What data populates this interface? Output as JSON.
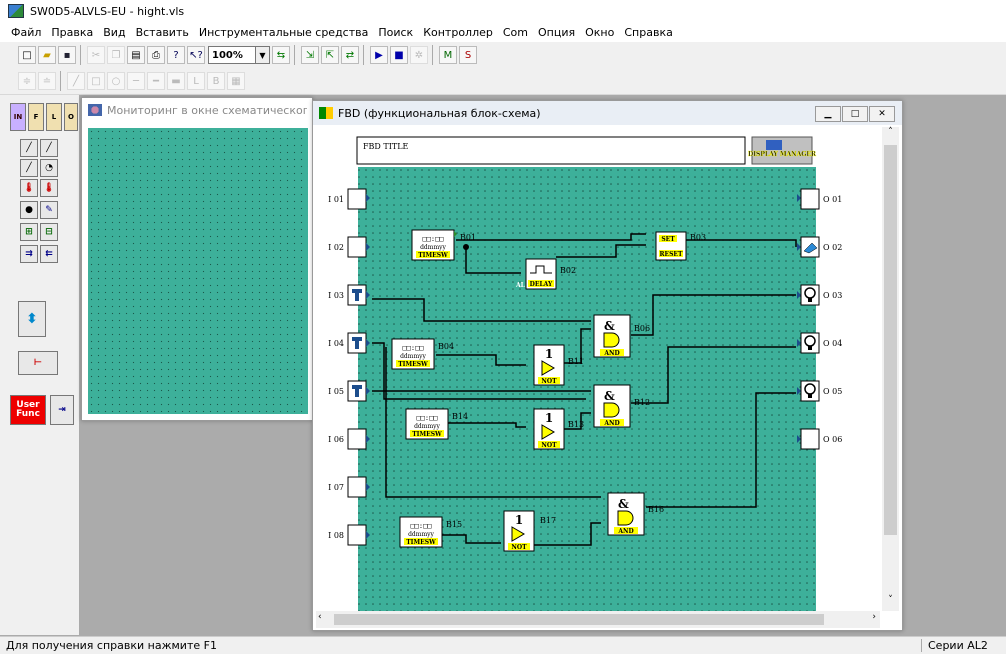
{
  "app": {
    "title": "SW0D5-ALVLS-EU - hight.vls"
  },
  "menu": [
    "Файл",
    "Правка",
    "Вид",
    "Вставить",
    "Инструментальные средства",
    "Поиск",
    "Контроллер",
    "Com",
    "Опция",
    "Окно",
    "Справка"
  ],
  "toolbar": {
    "zoom": "100%"
  },
  "left_panel": {
    "user_func_label": "User Func"
  },
  "monitor_window": {
    "title": "Мониторинг в окне схематического пред"
  },
  "fbd_window": {
    "title": "FBD (функциональная блок-схема)",
    "fbd_title": "FBD TITLE",
    "display_manager": "DISPLAY MANAGER",
    "inputs": [
      "I 01",
      "I 02",
      "I 03",
      "I 04",
      "I 05",
      "I 06",
      "I 07",
      "I 08"
    ],
    "outputs": [
      "O 01",
      "O 02",
      "O 03",
      "O 04",
      "O 05",
      "O 06"
    ],
    "blocks": {
      "b01": "B01",
      "b02": "B02",
      "b03": "B03",
      "b04": "B04",
      "b06": "B06",
      "b11": "B11",
      "b12": "B12",
      "b13": "B13",
      "b14": "B14",
      "b15": "B15",
      "b16": "B16",
      "b17": "B17"
    },
    "timesw_label": "TIMESW",
    "timesw_clock": "□□:□□",
    "timesw_date": "ddmmyy",
    "delay_label": "DELAY",
    "delay_tag": "AL",
    "set_label": "SET",
    "reset_label": "RESET",
    "and_label": "AND",
    "and_symbol": "&",
    "not_label": "NOT",
    "not_symbol": "1"
  },
  "status": {
    "help": "Для получения справки нажмите F1",
    "series": "Серии AL2"
  },
  "colors": {
    "canvas": "#3db09a",
    "dot": "#1b5a4c"
  }
}
